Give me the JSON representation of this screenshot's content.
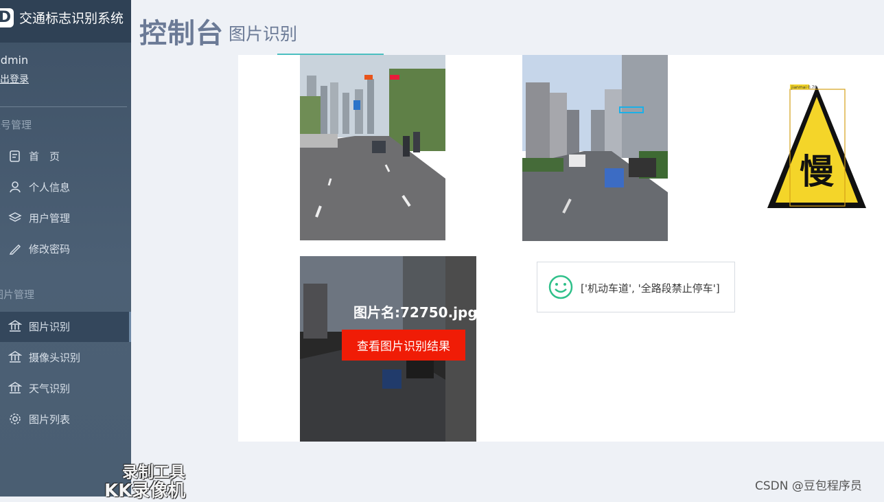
{
  "brand": {
    "logo_letter": "D",
    "title": "交通标志识别系统"
  },
  "user": {
    "name": "admin",
    "logout": "退出登录"
  },
  "sidebar": {
    "section_account": "账号管理",
    "section_image": "图片管理",
    "items": [
      {
        "label": "首　页",
        "icon": "home-doc-icon"
      },
      {
        "label": "个人信息",
        "icon": "user-icon"
      },
      {
        "label": "用户管理",
        "icon": "layers-icon"
      },
      {
        "label": "修改密码",
        "icon": "pencil-icon"
      },
      {
        "label": "图片识别",
        "icon": "bank-icon",
        "active": true
      },
      {
        "label": "摄像头识别",
        "icon": "bank-icon"
      },
      {
        "label": "天气识别",
        "icon": "bank-icon"
      },
      {
        "label": "图片列表",
        "icon": "gear-icon"
      }
    ]
  },
  "header": {
    "title": "控制台",
    "subtitle": "图片识别"
  },
  "main": {
    "overlay": {
      "filename": "图片名:72750.jpg",
      "button": "查看图片识别结果"
    },
    "result": "['机动车道', '全路段禁止停车']",
    "sign_char": "慢",
    "detections": [
      "jianmai 0.78"
    ]
  },
  "watermark": {
    "tool": "录制工具",
    "app": "KK录像机"
  },
  "credit": "CSDN @豆包程序员",
  "colors": {
    "sidebar": "#4c6075",
    "brand_bar": "#2f4155",
    "button": "#f01c06",
    "title": "#6b7a96"
  }
}
